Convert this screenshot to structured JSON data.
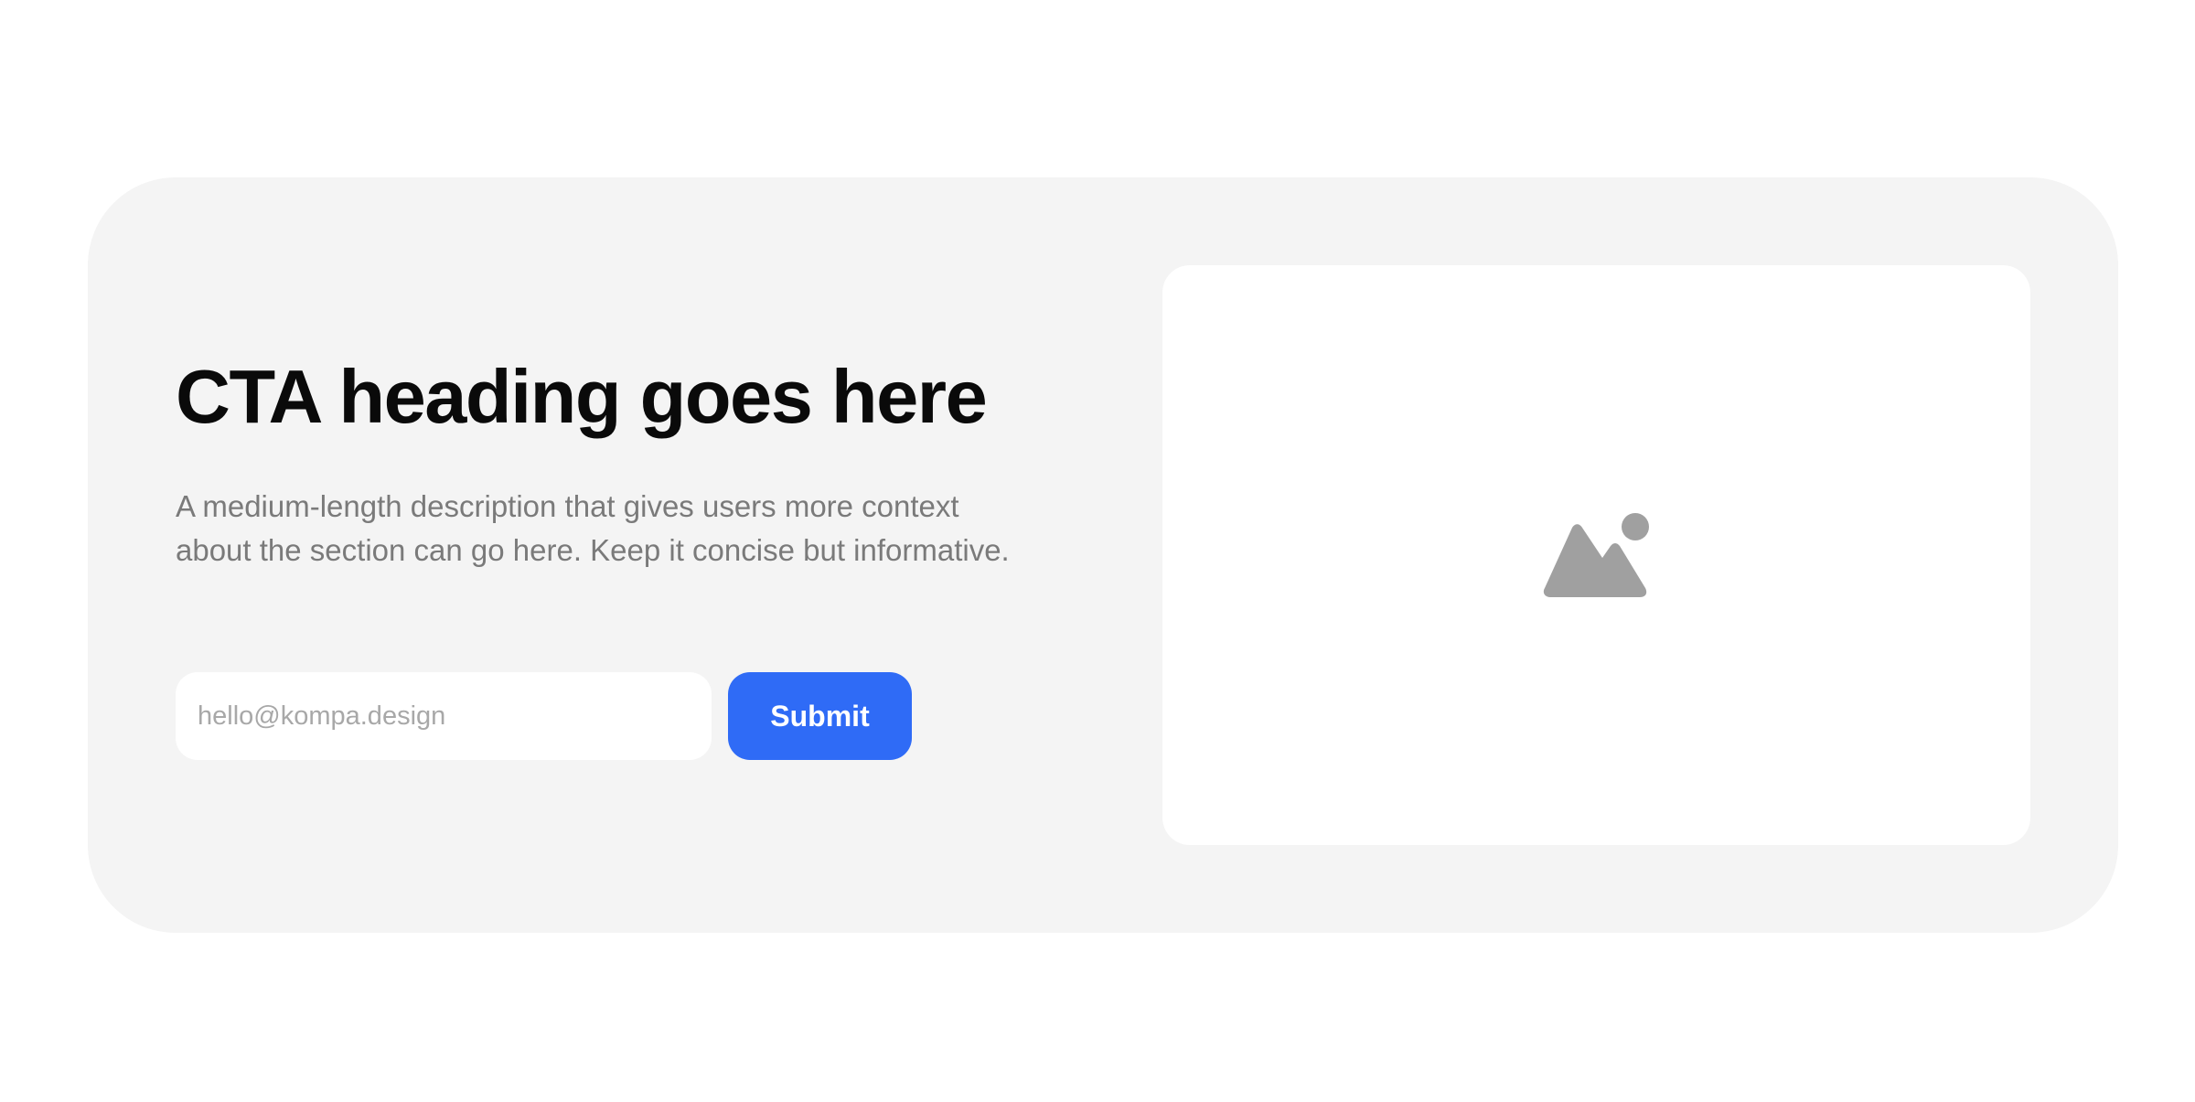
{
  "cta": {
    "heading": "CTA heading goes here",
    "description": "A medium-length description that gives users more context about the section can go here. Keep it concise but informative.",
    "email_placeholder": "hello@kompa.design",
    "submit_label": "Submit"
  },
  "media": {
    "icon": "image-placeholder-icon"
  },
  "colors": {
    "page_background": "#ffffff",
    "card_background": "#f4f4f4",
    "heading_text": "#0a0a0a",
    "body_text": "#7a7a7a",
    "placeholder_text": "#a8a8a8",
    "accent_button": "#2f6bf6",
    "icon_gray": "#a0a0a0"
  }
}
